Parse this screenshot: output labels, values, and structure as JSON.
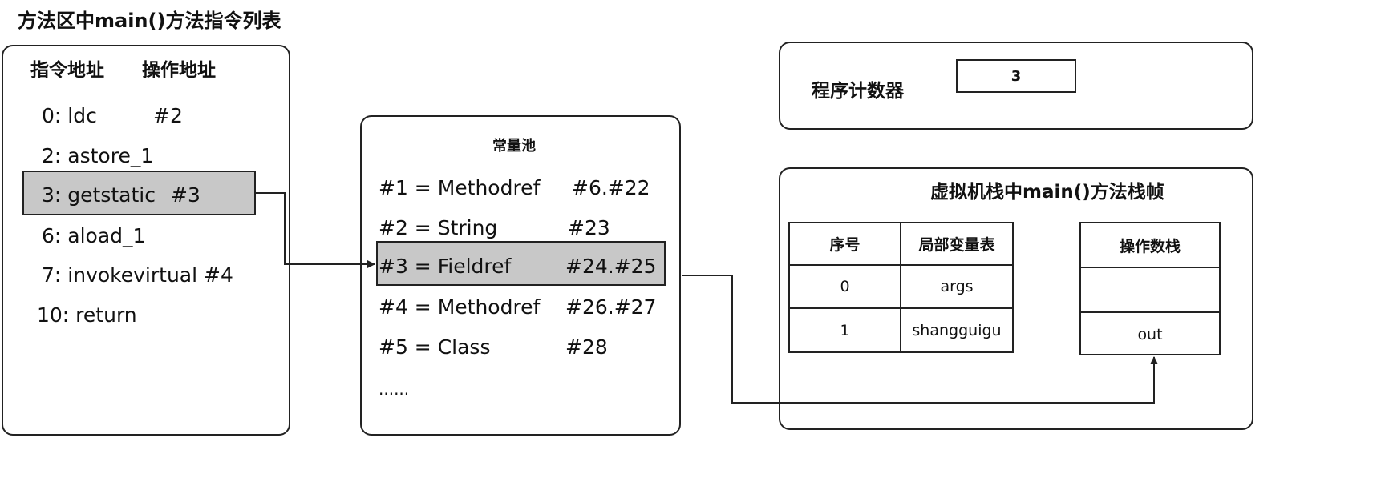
{
  "page_title": "方法区中main()方法指令列表",
  "method_area": {
    "header_addr": "指令地址",
    "header_op": "操作地址",
    "instructions": [
      {
        "addr": "0: ldc",
        "op": "#2"
      },
      {
        "addr": "2: astore_1",
        "op": ""
      },
      {
        "addr": "3: getstatic",
        "op": "#3"
      },
      {
        "addr": "6: aload_1",
        "op": ""
      },
      {
        "addr": "7: invokevirtual #4",
        "op": ""
      },
      {
        "addr": "10: return",
        "op": ""
      }
    ]
  },
  "constant_pool": {
    "title": "常量池",
    "entries": [
      {
        "name": "#1 = Methodref",
        "ref": "#6.#22"
      },
      {
        "name": "#2 = String",
        "ref": "#23"
      },
      {
        "name": "#3 = Fieldref",
        "ref": "#24.#25"
      },
      {
        "name": "#4 = Methodref",
        "ref": "#26.#27"
      },
      {
        "name": "#5 = Class",
        "ref": "#28"
      }
    ],
    "ellipsis": "......"
  },
  "program_counter": {
    "label": "程序计数器",
    "value": "3"
  },
  "stack_frame": {
    "title": "虚拟机栈中main()方法栈帧",
    "local_vars": {
      "col_index": "序号",
      "col_table": "局部变量表",
      "rows": [
        {
          "index": "0",
          "value": "args"
        },
        {
          "index": "1",
          "value": "shangguigu"
        }
      ]
    },
    "operand_stack": {
      "title": "操作数栈",
      "slots": [
        "",
        "out"
      ]
    }
  }
}
